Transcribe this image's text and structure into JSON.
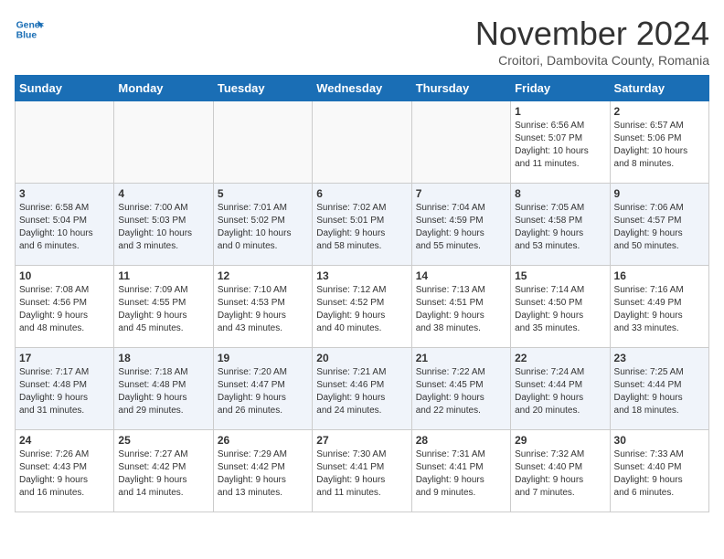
{
  "header": {
    "logo_line1": "General",
    "logo_line2": "Blue",
    "month_title": "November 2024",
    "location": "Croitori, Dambovita County, Romania"
  },
  "days_of_week": [
    "Sunday",
    "Monday",
    "Tuesday",
    "Wednesday",
    "Thursday",
    "Friday",
    "Saturday"
  ],
  "weeks": [
    [
      {
        "day": "",
        "info": ""
      },
      {
        "day": "",
        "info": ""
      },
      {
        "day": "",
        "info": ""
      },
      {
        "day": "",
        "info": ""
      },
      {
        "day": "",
        "info": ""
      },
      {
        "day": "1",
        "info": "Sunrise: 6:56 AM\nSunset: 5:07 PM\nDaylight: 10 hours\nand 11 minutes."
      },
      {
        "day": "2",
        "info": "Sunrise: 6:57 AM\nSunset: 5:06 PM\nDaylight: 10 hours\nand 8 minutes."
      }
    ],
    [
      {
        "day": "3",
        "info": "Sunrise: 6:58 AM\nSunset: 5:04 PM\nDaylight: 10 hours\nand 6 minutes."
      },
      {
        "day": "4",
        "info": "Sunrise: 7:00 AM\nSunset: 5:03 PM\nDaylight: 10 hours\nand 3 minutes."
      },
      {
        "day": "5",
        "info": "Sunrise: 7:01 AM\nSunset: 5:02 PM\nDaylight: 10 hours\nand 0 minutes."
      },
      {
        "day": "6",
        "info": "Sunrise: 7:02 AM\nSunset: 5:01 PM\nDaylight: 9 hours\nand 58 minutes."
      },
      {
        "day": "7",
        "info": "Sunrise: 7:04 AM\nSunset: 4:59 PM\nDaylight: 9 hours\nand 55 minutes."
      },
      {
        "day": "8",
        "info": "Sunrise: 7:05 AM\nSunset: 4:58 PM\nDaylight: 9 hours\nand 53 minutes."
      },
      {
        "day": "9",
        "info": "Sunrise: 7:06 AM\nSunset: 4:57 PM\nDaylight: 9 hours\nand 50 minutes."
      }
    ],
    [
      {
        "day": "10",
        "info": "Sunrise: 7:08 AM\nSunset: 4:56 PM\nDaylight: 9 hours\nand 48 minutes."
      },
      {
        "day": "11",
        "info": "Sunrise: 7:09 AM\nSunset: 4:55 PM\nDaylight: 9 hours\nand 45 minutes."
      },
      {
        "day": "12",
        "info": "Sunrise: 7:10 AM\nSunset: 4:53 PM\nDaylight: 9 hours\nand 43 minutes."
      },
      {
        "day": "13",
        "info": "Sunrise: 7:12 AM\nSunset: 4:52 PM\nDaylight: 9 hours\nand 40 minutes."
      },
      {
        "day": "14",
        "info": "Sunrise: 7:13 AM\nSunset: 4:51 PM\nDaylight: 9 hours\nand 38 minutes."
      },
      {
        "day": "15",
        "info": "Sunrise: 7:14 AM\nSunset: 4:50 PM\nDaylight: 9 hours\nand 35 minutes."
      },
      {
        "day": "16",
        "info": "Sunrise: 7:16 AM\nSunset: 4:49 PM\nDaylight: 9 hours\nand 33 minutes."
      }
    ],
    [
      {
        "day": "17",
        "info": "Sunrise: 7:17 AM\nSunset: 4:48 PM\nDaylight: 9 hours\nand 31 minutes."
      },
      {
        "day": "18",
        "info": "Sunrise: 7:18 AM\nSunset: 4:48 PM\nDaylight: 9 hours\nand 29 minutes."
      },
      {
        "day": "19",
        "info": "Sunrise: 7:20 AM\nSunset: 4:47 PM\nDaylight: 9 hours\nand 26 minutes."
      },
      {
        "day": "20",
        "info": "Sunrise: 7:21 AM\nSunset: 4:46 PM\nDaylight: 9 hours\nand 24 minutes."
      },
      {
        "day": "21",
        "info": "Sunrise: 7:22 AM\nSunset: 4:45 PM\nDaylight: 9 hours\nand 22 minutes."
      },
      {
        "day": "22",
        "info": "Sunrise: 7:24 AM\nSunset: 4:44 PM\nDaylight: 9 hours\nand 20 minutes."
      },
      {
        "day": "23",
        "info": "Sunrise: 7:25 AM\nSunset: 4:44 PM\nDaylight: 9 hours\nand 18 minutes."
      }
    ],
    [
      {
        "day": "24",
        "info": "Sunrise: 7:26 AM\nSunset: 4:43 PM\nDaylight: 9 hours\nand 16 minutes."
      },
      {
        "day": "25",
        "info": "Sunrise: 7:27 AM\nSunset: 4:42 PM\nDaylight: 9 hours\nand 14 minutes."
      },
      {
        "day": "26",
        "info": "Sunrise: 7:29 AM\nSunset: 4:42 PM\nDaylight: 9 hours\nand 13 minutes."
      },
      {
        "day": "27",
        "info": "Sunrise: 7:30 AM\nSunset: 4:41 PM\nDaylight: 9 hours\nand 11 minutes."
      },
      {
        "day": "28",
        "info": "Sunrise: 7:31 AM\nSunset: 4:41 PM\nDaylight: 9 hours\nand 9 minutes."
      },
      {
        "day": "29",
        "info": "Sunrise: 7:32 AM\nSunset: 4:40 PM\nDaylight: 9 hours\nand 7 minutes."
      },
      {
        "day": "30",
        "info": "Sunrise: 7:33 AM\nSunset: 4:40 PM\nDaylight: 9 hours\nand 6 minutes."
      }
    ]
  ]
}
